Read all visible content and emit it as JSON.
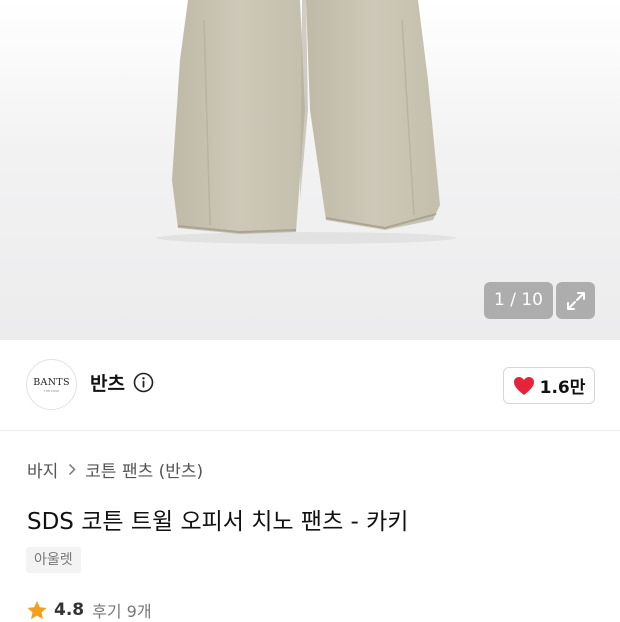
{
  "gallery": {
    "counter": "1 / 10",
    "product_color": "#c9c4b3"
  },
  "brand": {
    "logo_text": "BANTS",
    "logo_subtext": "THE SHOP",
    "name": "반츠",
    "like_count": "1.6만",
    "like_color": "#e5233b"
  },
  "breadcrumb": {
    "items": [
      "바지",
      "코튼 팬츠 (반츠)"
    ]
  },
  "product": {
    "title": "SDS 코튼 트윌 오피서 치노 팬츠 - 카키",
    "tag": "아울렛"
  },
  "rating": {
    "score": "4.8",
    "reviews": "후기 9개",
    "star_color": "#f2a01e"
  }
}
